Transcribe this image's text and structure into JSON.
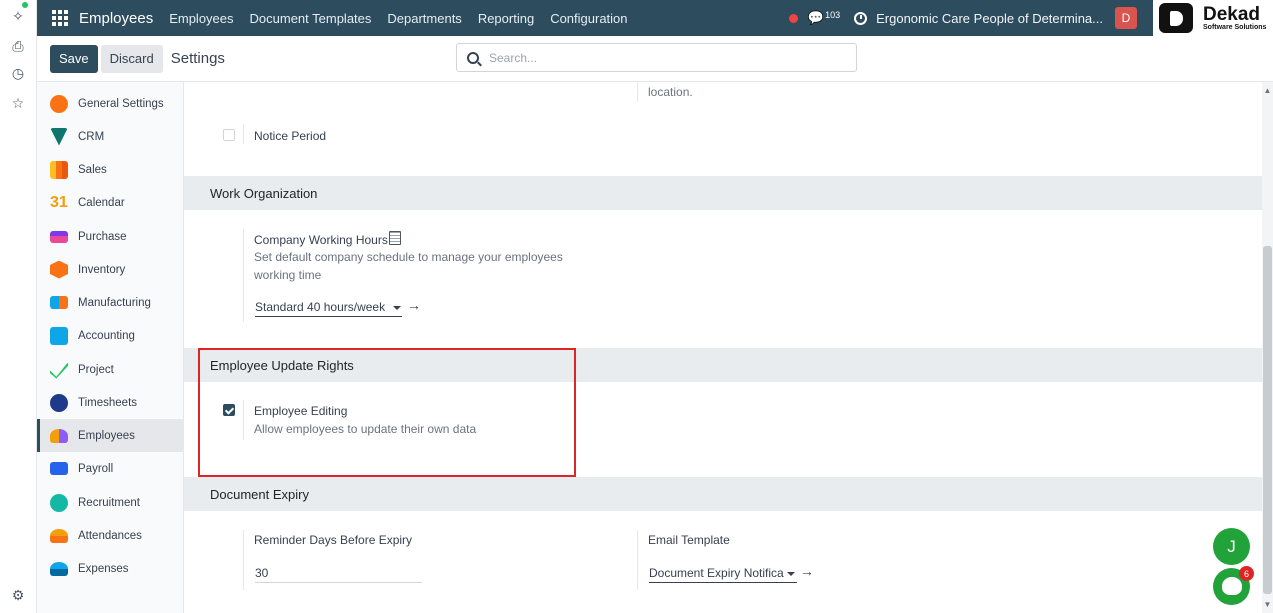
{
  "rail": {
    "icons": [
      "sparkle-icon",
      "print-icon",
      "clock-icon",
      "star-icon",
      "gear-icon"
    ]
  },
  "navbar": {
    "app_name": "Employees",
    "menu": [
      "Employees",
      "Document Templates",
      "Departments",
      "Reporting",
      "Configuration"
    ],
    "chat_count": "103",
    "company": "Ergonomic Care People of Determina...",
    "avatar_initial": "D"
  },
  "logo": {
    "name": "Dekad",
    "tagline": "Software Solutions"
  },
  "control_panel": {
    "save_label": "Save",
    "discard_label": "Discard",
    "title": "Settings",
    "search_placeholder": "Search..."
  },
  "sidebar": {
    "items": [
      {
        "label": "General Settings",
        "color": "#f97316"
      },
      {
        "label": "CRM",
        "color": "#0f766e"
      },
      {
        "label": "Sales",
        "color": "#f59e0b"
      },
      {
        "label": "Calendar",
        "color": "#f59e0b"
      },
      {
        "label": "Purchase",
        "color": "#7c3aed"
      },
      {
        "label": "Inventory",
        "color": "#f97316"
      },
      {
        "label": "Manufacturing",
        "color": "#0ea5e9"
      },
      {
        "label": "Accounting",
        "color": "#0ea5e9"
      },
      {
        "label": "Project",
        "color": "#22c55e"
      },
      {
        "label": "Timesheets",
        "color": "#1e3a8a"
      },
      {
        "label": "Employees",
        "color": "#8b5cf6"
      },
      {
        "label": "Payroll",
        "color": "#2563eb"
      },
      {
        "label": "Recruitment",
        "color": "#14b8a6"
      },
      {
        "label": "Attendances",
        "color": "#f59e0b"
      },
      {
        "label": "Expenses",
        "color": "#0ea5e9"
      }
    ],
    "active": "Employees"
  },
  "main": {
    "top_fragment": "location.",
    "notice_period": {
      "label": "Notice Period",
      "checked": false
    },
    "work_org": {
      "heading": "Work Organization",
      "title": "Company Working Hours",
      "desc_line1": "Set default company schedule to manage your employees",
      "desc_line2": "working time",
      "value": "Standard 40 hours/week"
    },
    "update_rights": {
      "heading": "Employee Update Rights",
      "title": "Employee Editing",
      "desc": "Allow employees to update their own data",
      "checked": true
    },
    "doc_expiry": {
      "heading": "Document Expiry",
      "reminder_label": "Reminder Days Before Expiry",
      "reminder_value": "30",
      "template_label": "Email Template",
      "template_value": "Document Expiry Notifica"
    }
  },
  "floating": {
    "avatar_letter": "J",
    "badge_count": "6"
  }
}
